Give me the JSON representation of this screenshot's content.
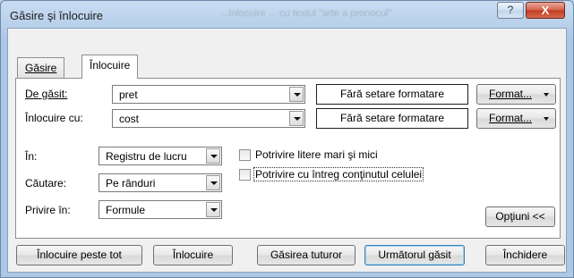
{
  "window": {
    "title": "Găsire şi înlocuire",
    "title_ghost": "...Inlocuire ... cu textul \"arte a pronocul\"",
    "help_label": "?",
    "close_label": "X"
  },
  "tabs": [
    {
      "label": "Găsire",
      "active": false
    },
    {
      "label": "Înlocuire",
      "active": true
    }
  ],
  "find": {
    "label": "De găsit:",
    "value": "pret",
    "preview": "Fără setare formatare",
    "format_label": "Format..."
  },
  "replace": {
    "label": "Înlocuire cu:",
    "value": "cost",
    "preview": "Fără setare formatare",
    "format_label": "Format..."
  },
  "options": {
    "within": {
      "label": "În:",
      "value": "Registru de lucru"
    },
    "search": {
      "label": "Căutare:",
      "value": "Pe rânduri"
    },
    "look_in": {
      "label": "Privire în:",
      "value": "Formule"
    },
    "match_case": {
      "label": "Potrivire litere mari şi mici",
      "checked": false
    },
    "match_entire": {
      "label": "Potrivire cu întreg conţinutul celulei",
      "checked": false
    },
    "options_button": "Opţiuni <<"
  },
  "actions": {
    "replace_all": "Înlocuire peste tot",
    "replace": "Înlocuire",
    "find_all": "Găsirea tuturor",
    "find_next": "Următorul găsit",
    "close": "Închidere"
  }
}
